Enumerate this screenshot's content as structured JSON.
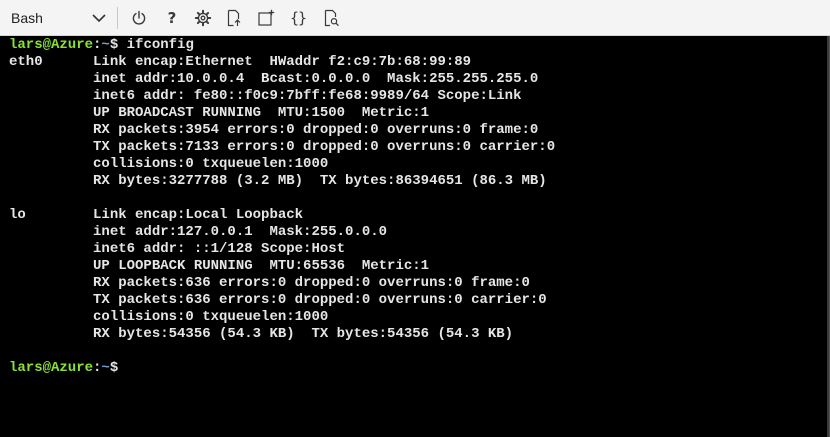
{
  "toolbar": {
    "shell": "Bash",
    "buttons": [
      {
        "name": "restart",
        "icon": "power-icon"
      },
      {
        "name": "help",
        "icon": "question-icon",
        "glyph": "?"
      },
      {
        "name": "settings",
        "icon": "gear-icon"
      },
      {
        "name": "upload-download",
        "icon": "file-transfer-icon"
      },
      {
        "name": "new-session",
        "icon": "new-session-icon"
      },
      {
        "name": "editor",
        "icon": "braces-icon",
        "glyph": "{}"
      },
      {
        "name": "web-preview",
        "icon": "web-preview-icon"
      }
    ]
  },
  "colors": {
    "prompt_user": "#8ae234",
    "prompt_path": "#729fcf",
    "output_text": "#e6e6e6",
    "terminal_bg": "#000000",
    "toolbar_bg": "#f4f4f4"
  },
  "terminal": {
    "prompt": {
      "user_host": "lars@Azure",
      "separator": ":",
      "path": "~",
      "symbol": "$ "
    },
    "command": "ifconfig",
    "output": [
      "eth0      Link encap:Ethernet  HWaddr f2:c9:7b:68:99:89",
      "          inet addr:10.0.0.4  Bcast:0.0.0.0  Mask:255.255.255.0",
      "          inet6 addr: fe80::f0c9:7bff:fe68:9989/64 Scope:Link",
      "          UP BROADCAST RUNNING  MTU:1500  Metric:1",
      "          RX packets:3954 errors:0 dropped:0 overruns:0 frame:0",
      "          TX packets:7133 errors:0 dropped:0 overruns:0 carrier:0",
      "          collisions:0 txqueuelen:1000",
      "          RX bytes:3277788 (3.2 MB)  TX bytes:86394651 (86.3 MB)",
      "",
      "lo        Link encap:Local Loopback",
      "          inet addr:127.0.0.1  Mask:255.0.0.0",
      "          inet6 addr: ::1/128 Scope:Host",
      "          UP LOOPBACK RUNNING  MTU:65536  Metric:1",
      "          RX packets:636 errors:0 dropped:0 overruns:0 frame:0",
      "          TX packets:636 errors:0 dropped:0 overruns:0 carrier:0",
      "          collisions:0 txqueuelen:1000",
      "          RX bytes:54356 (54.3 KB)  TX bytes:54356 (54.3 KB)",
      ""
    ]
  }
}
